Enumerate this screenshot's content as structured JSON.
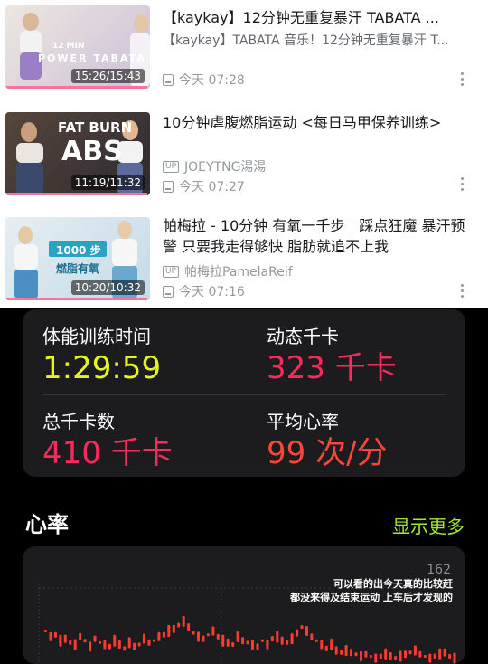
{
  "videos": [
    {
      "title": "【kaykay】12分钟无重复暴汗 TABATA ...",
      "subtitle": "【kaykay】TABATA 音乐！12分钟无重复暴汗 T...",
      "uploader": "",
      "time": "今天 07:28",
      "duration": "15:26/15:43",
      "progress": 0.98,
      "thumb_caption_top": "12 MIN",
      "thumb_caption": "POWER TABATA",
      "thumb_colors": [
        "#e9e4dc",
        "#c6b7d6"
      ]
    },
    {
      "title": "10分钟虐腹燃脂运动 <每日马甲保养训练>",
      "subtitle": "",
      "uploader": "JOEYTNG湯湯",
      "time": "今天 07:27",
      "duration": "11:19/11:32",
      "progress": 0.98,
      "thumb_caption_top": "FAT BURN",
      "thumb_caption": "ABS",
      "thumb_colors": [
        "#4b3b30",
        "#2d2a34"
      ]
    },
    {
      "title": "帕梅拉 - 10分钟 有氧一千步｜踩点狂魔 暴汗预警 只要我走得够快 脂肪就追不上我",
      "subtitle": "",
      "uploader": "帕梅拉PamelaReif",
      "time": "今天 07:16",
      "duration": "10:20/10:32",
      "progress": 0.98,
      "thumb_caption_top": "1000 步",
      "thumb_caption": "燃脂有氧",
      "thumb_colors": [
        "#dfe9ef",
        "#bfd7e4"
      ]
    }
  ],
  "up_badge": "UP",
  "summary": {
    "training_time_label": "体能训练时间",
    "training_time": "1:29:59",
    "active_kcal_label": "动态千卡",
    "active_kcal": "323 千卡",
    "total_kcal_label": "总千卡数",
    "total_kcal": "410 千卡",
    "avg_hr_label": "平均心率",
    "avg_hr": "99 次/分"
  },
  "colors": {
    "yellow": "#e6f51f",
    "red": "#fb2a5c",
    "orange": "#ff453a",
    "green": "#a3e635",
    "bili_pink": "#fb7299"
  },
  "heart_rate": {
    "title": "心率",
    "show_more": "显示更多",
    "max_label": "162",
    "annotation_line1": "可以看的出今天真的比较赶",
    "annotation_line2": "都没来得及结束运动 上车后才发现的"
  },
  "chart_data": {
    "type": "bar",
    "title": "心率",
    "ylim": [
      60,
      162
    ],
    "values": [
      118,
      112,
      114,
      108,
      110,
      106,
      104,
      112,
      108,
      102,
      110,
      106,
      104,
      102,
      108,
      104,
      100,
      106,
      102,
      104,
      110,
      106,
      108,
      112,
      114,
      118,
      120,
      124,
      128,
      122,
      116,
      112,
      110,
      114,
      118,
      112,
      108,
      106,
      104,
      112,
      108,
      106,
      104,
      102,
      108,
      104,
      110,
      112,
      108,
      106,
      110,
      116,
      122,
      118,
      112,
      108,
      104,
      100,
      104,
      98,
      96,
      98,
      96,
      94,
      92,
      94,
      92,
      90,
      92,
      94,
      92,
      90,
      92,
      94,
      96,
      98,
      94,
      92,
      90,
      92,
      94,
      96,
      92,
      90
    ]
  }
}
